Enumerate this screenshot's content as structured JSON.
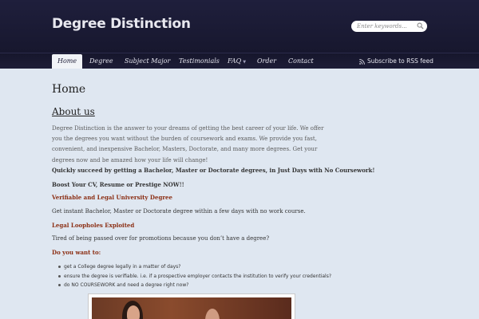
{
  "header": {
    "site_title": "Degree Distinction",
    "search_placeholder": "Enter keywords..."
  },
  "nav": {
    "items": [
      {
        "label": "Home",
        "active": true
      },
      {
        "label": "Degree"
      },
      {
        "label": "Subject Major"
      },
      {
        "label": "Testimonials"
      },
      {
        "label": "FAQ"
      },
      {
        "label": "Order"
      },
      {
        "label": "Contact"
      }
    ],
    "rss_label": "Subscribe to RSS feed"
  },
  "main": {
    "page_title": "Home",
    "section_title": "About us",
    "intro": "Degree Distinction is the answer to your dreams of getting the best career of your life.  We offer you the degrees you want without the burden of coursework and exams.  We provide you fast, convenient, and inexpensive Bachelor, Masters, Doctorate, and many more degrees. Get your degrees now and be amazed how your life will change!",
    "p1": "Quickly succeed by getting a Bachelor, Master or Doctorate degrees, in Just Days with No Coursework!",
    "p2": "Boost Your CV, Resume or Prestige NOW!!",
    "h_verifiable": "Verifiable and Legal University Degree",
    "p3": "Get instant Bachelor, Master or Doctorate degree within a few days with no work course.",
    "h_loopholes": "Legal Loopholes Exploited",
    "p4": "Tired of being passed over for promotions because you don’t have a degree?",
    "h_want": "Do you want to:",
    "list": [
      "get a College degree legally in a matter of days?",
      "ensure the degree is verifiable. i.e. if a prospective employer contacts the institution to verify your credentials?",
      "do NO COURSEWORK and need a degree right now?"
    ]
  },
  "colors": {
    "header_bg": "#1f1f3c",
    "page_bg": "#dfe7f1",
    "accent_red": "#8b2e13"
  }
}
